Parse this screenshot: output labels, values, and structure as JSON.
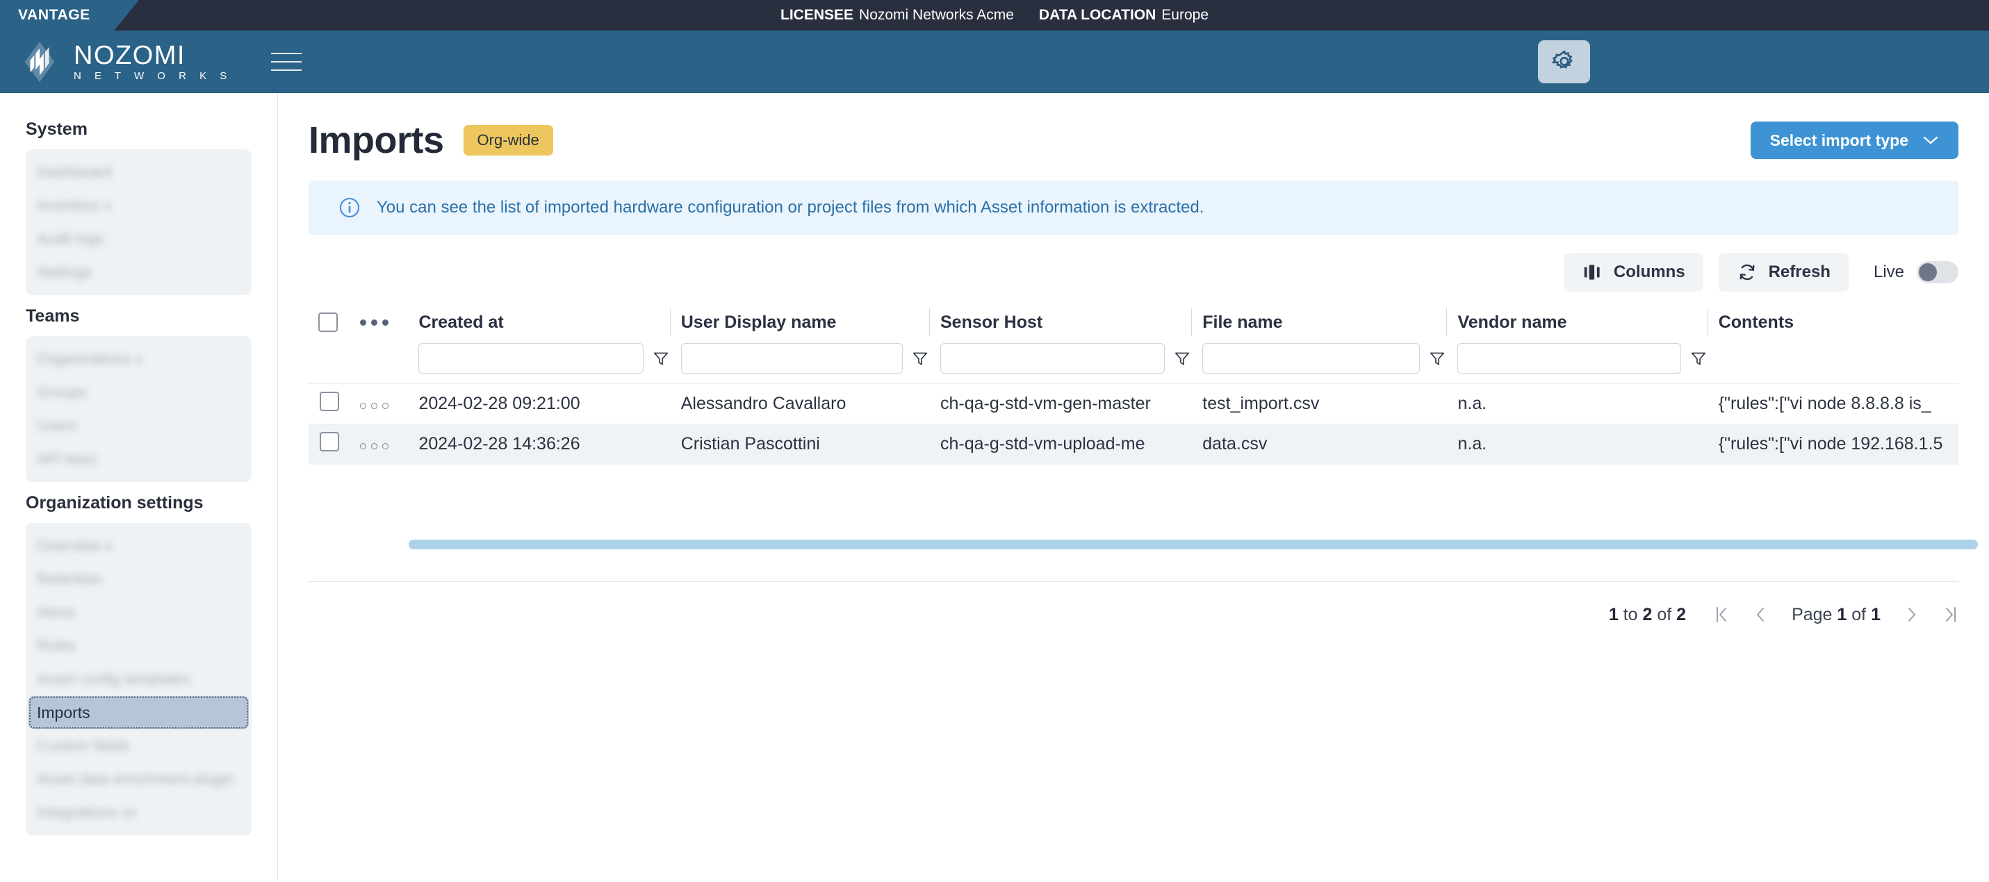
{
  "topbar": {
    "product": "VANTAGE",
    "licensee_label": "LICENSEE",
    "licensee_value": "Nozomi Networks Acme",
    "data_location_label": "DATA LOCATION",
    "data_location_value": "Europe"
  },
  "brand": {
    "name": "NOZOMI",
    "subname": "N E T W O R K S"
  },
  "sidebar": {
    "sections": [
      {
        "title": "System",
        "items": [
          {
            "label": "",
            "blurred": true,
            "active": false
          },
          {
            "label": "",
            "blurred": true,
            "active": false
          },
          {
            "label": "",
            "blurred": true,
            "active": false
          },
          {
            "label": "",
            "blurred": true,
            "active": false
          }
        ]
      },
      {
        "title": "Teams",
        "items": [
          {
            "label": "",
            "blurred": true,
            "active": false
          },
          {
            "label": "",
            "blurred": true,
            "active": false
          },
          {
            "label": "",
            "blurred": true,
            "active": false
          },
          {
            "label": "",
            "blurred": true,
            "active": false
          }
        ]
      },
      {
        "title": "Organization settings",
        "items": [
          {
            "label": "",
            "blurred": true,
            "active": false
          },
          {
            "label": "",
            "blurred": true,
            "active": false
          },
          {
            "label": "",
            "blurred": true,
            "active": false
          },
          {
            "label": "",
            "blurred": true,
            "active": false
          },
          {
            "label": "",
            "blurred": true,
            "active": false
          },
          {
            "label": "Imports",
            "blurred": false,
            "active": true
          },
          {
            "label": "",
            "blurred": true,
            "active": false
          },
          {
            "label": "",
            "blurred": true,
            "active": false
          },
          {
            "label": "",
            "blurred": true,
            "active": false
          }
        ]
      }
    ]
  },
  "page": {
    "title": "Imports",
    "badge": "Org-wide",
    "primary_button": "Select import type",
    "info_message": "You can see the list of imported hardware configuration or project files from which Asset information is extracted."
  },
  "toolbar": {
    "columns_label": "Columns",
    "refresh_label": "Refresh",
    "live_label": "Live",
    "live_on": false
  },
  "table": {
    "columns": [
      "Created at",
      "User Display name",
      "Sensor Host",
      "File name",
      "Vendor name",
      "Contents"
    ],
    "filters": [
      "",
      "",
      "",
      "",
      ""
    ],
    "filter_placeholder": "",
    "rows": [
      {
        "created_at": "2024-02-28 09:21:00",
        "user_display_name": "Alessandro Cavallaro",
        "sensor_host": "ch-qa-g-std-vm-gen-master",
        "file_name": "test_import.csv",
        "vendor_name": "n.a.",
        "contents": "{\"rules\":[\"vi node 8.8.8.8 is_"
      },
      {
        "created_at": "2024-02-28 14:36:26",
        "user_display_name": "Cristian Pascottini",
        "sensor_host": "ch-qa-g-std-vm-upload-me",
        "file_name": "data.csv",
        "vendor_name": "n.a.",
        "contents": "{\"rules\":[\"vi node 192.168.1.5"
      }
    ]
  },
  "footer": {
    "range_prefix": "1",
    "range_to": "to",
    "range_mid": "2",
    "range_of": "of",
    "range_total": "2",
    "page_word": "Page",
    "page_current": "1",
    "page_of": "of",
    "page_total": "1"
  },
  "colors": {
    "brand_blue": "#2b6287",
    "topbar_dark": "#292f3f",
    "accent_blue": "#3d93d3",
    "badge_yellow": "#edc75d",
    "info_bg": "#eaf4fc",
    "info_text": "#2a6fa8",
    "scrollbar": "#add2e8",
    "sidebar_active": "#b6c6d6"
  }
}
